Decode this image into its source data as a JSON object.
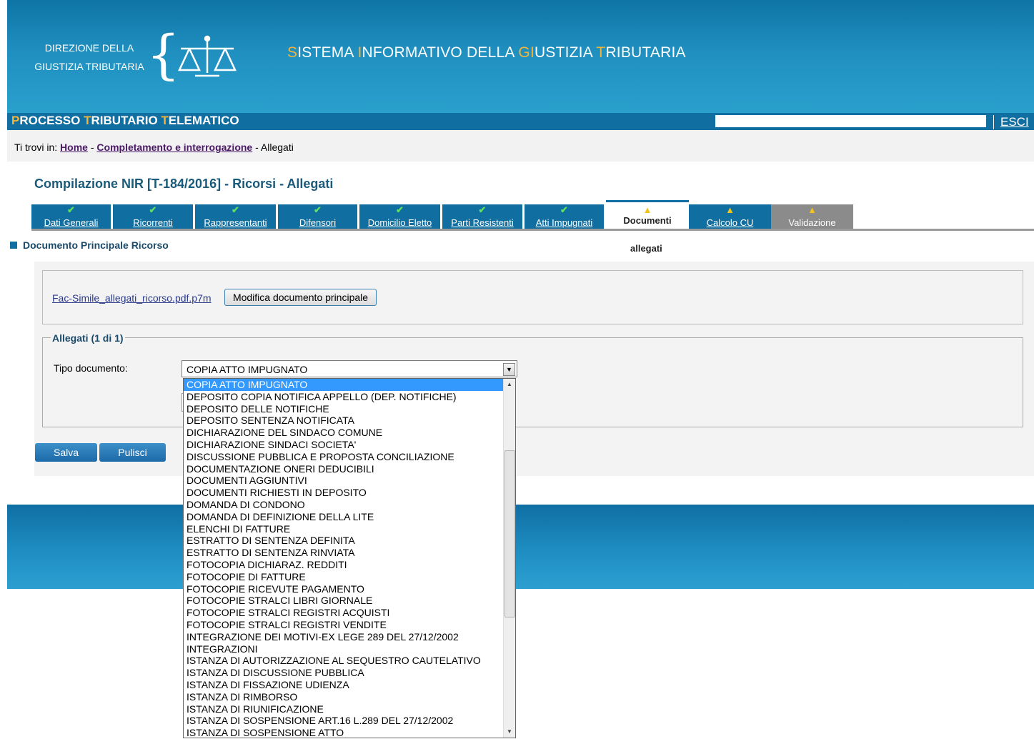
{
  "header": {
    "org_line1": "DIREZIONE DELLA",
    "org_line2": "GIUSTIZIA TRIBUTARIA",
    "app_title_parts": [
      "S",
      "ISTEMA ",
      "I",
      "NFORMATIVO DELLA ",
      "GI",
      "USTIZIA ",
      "T",
      "RIBUTARIA"
    ],
    "subsystem_parts": [
      "P",
      "ROCESSO ",
      "T",
      "RIBUTARIO ",
      "T",
      "ELEMATICO"
    ],
    "logout_label": "ESCI"
  },
  "breadcrumb": {
    "prefix": "Ti trovi in:",
    "home": "Home",
    "sep": "-",
    "completamento": "Completamento e interrogazione",
    "current": "Allegati"
  },
  "page_title": "Compilazione NIR [T-184/2016] - Ricorsi - Allegati",
  "tabs": [
    {
      "label": "Dati Generali",
      "status": "ok"
    },
    {
      "label": "Ricorrenti",
      "status": "ok"
    },
    {
      "label": "Rappresentanti",
      "status": "ok"
    },
    {
      "label": "Difensori",
      "status": "ok"
    },
    {
      "label": "Domicilio Eletto",
      "status": "ok"
    },
    {
      "label": "Parti Resistenti",
      "status": "ok"
    },
    {
      "label": "Atti Impugnati",
      "status": "ok"
    },
    {
      "label": "Documenti",
      "status": "warning"
    },
    {
      "label": "Calcolo CU",
      "status": "warning"
    },
    {
      "label": "Validazione",
      "status": "warning"
    }
  ],
  "section_title": "Documento Principale Ricorso",
  "subtab_label": "allegati",
  "main_document": {
    "file_name": "Fac-Simile_allegati_ricorso.pdf.p7m",
    "modify_button": "Modifica documento principale"
  },
  "attachments": {
    "legend": "Allegati (1 di 1)",
    "tipo_label": "Tipo documento:",
    "selected": "COPIA ATTO IMPUGNATO",
    "options": [
      "COPIA ATTO IMPUGNATO",
      "DEPOSITO COPIA NOTIFICA APPELLO (DEP. NOTIFICHE)",
      "DEPOSITO DELLE NOTIFICHE",
      "DEPOSITO SENTENZA NOTIFICATA",
      "DICHIARAZIONE DEL SINDACO COMUNE",
      "DICHIARAZIONE SINDACI SOCIETA'",
      "DISCUSSIONE PUBBLICA E PROPOSTA CONCILIAZIONE",
      "DOCUMENTAZIONE ONERI DEDUCIBILI",
      "DOCUMENTI AGGIUNTIVI",
      "DOCUMENTI RICHIESTI IN DEPOSITO",
      "DOMANDA DI CONDONO",
      "DOMANDA DI DEFINIZIONE DELLA LITE",
      "ELENCHI DI FATTURE",
      "ESTRATTO DI SENTENZA DEFINITA",
      "ESTRATTO DI SENTENZA RINVIATA",
      "FOTOCOPIA DICHIARAZ. REDDITI",
      "FOTOCOPIE DI FATTURE",
      "FOTOCOPIE RICEVUTE PAGAMENTO",
      "FOTOCOPIE STRALCI LIBRI GIORNALE",
      "FOTOCOPIE STRALCI REGISTRI ACQUISTI",
      "FOTOCOPIE STRALCI REGISTRI VENDITE",
      "INTEGRAZIONE DEI MOTIVI-EX LEGE 289 DEL 27/12/2002",
      "INTEGRAZIONI",
      "ISTANZA DI AUTORIZZAZIONE AL SEQUESTRO CAUTELATIVO",
      "ISTANZA DI DISCUSSIONE PUBBLICA",
      "ISTANZA DI FISSAZIONE UDIENZA",
      "ISTANZA DI RIMBORSO",
      "ISTANZA DI RIUNIFICAZIONE",
      "ISTANZA DI SOSPENSIONE ART.16 L.289 DEL 27/12/2002",
      "ISTANZA DI SOSPENSIONE ATTO"
    ]
  },
  "buttons": {
    "save": "Salva",
    "clear": "Pulisci"
  },
  "colors": {
    "primary": "#116ea0",
    "accent": "#f4b43a",
    "ok": "#5fe05f",
    "warning": "#f3c21b",
    "selected": "#3399ff"
  },
  "icons": {
    "ok": "check-icon",
    "warning": "warning-icon",
    "logo": "scales-of-justice-icon"
  }
}
